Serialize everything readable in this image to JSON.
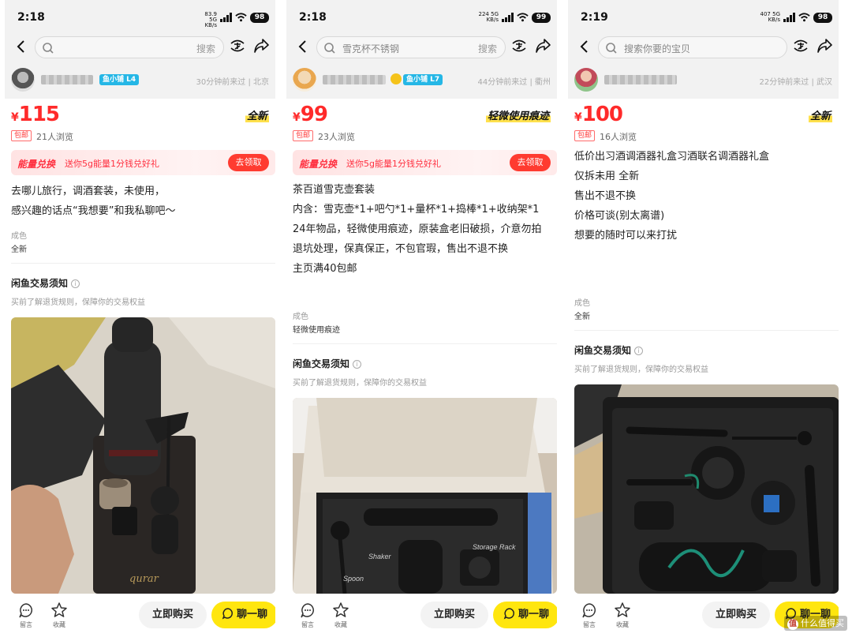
{
  "colors": {
    "accent": "#ffe60f",
    "price": "#ff2a2a",
    "promo": "#ff3b30",
    "badge": "#25b7e6"
  },
  "phones": [
    {
      "status": {
        "time": "2:18",
        "net_speed": "83.9",
        "net_gen": "5G",
        "net_unit": "KB/s",
        "battery": "98"
      },
      "search": {
        "placeholder": "",
        "button": "搜索"
      },
      "seller": {
        "badge": "鱼小铺 L4",
        "last_seen": "30分钟前来过 | 北京"
      },
      "price": {
        "currency": "¥",
        "value": "115"
      },
      "condition_tag": "全新",
      "shipping_tag": "包邮",
      "views": "21人浏览",
      "promo": {
        "title": "能量兑换",
        "text": "送你5g能量1分钱兑好礼",
        "button": "去领取"
      },
      "description": [
        "去哪儿旅行，调酒套装，未使用，",
        "感兴趣的话点“我想要”和我私聊吧～"
      ],
      "condition_label": "成色",
      "condition_value": "全新",
      "notice": {
        "title": "闲鱼交易须知",
        "info_icon": "i",
        "subtitle": "买前了解退货规则，保障你的交易权益"
      },
      "photo_text": "qurar",
      "bottom": {
        "comment_label": "留言",
        "favorite_label": "收藏",
        "buy": "立即购买",
        "chat": "聊一聊"
      }
    },
    {
      "status": {
        "time": "2:18",
        "net_speed": "224",
        "net_gen": "5G",
        "net_unit": "KB/s",
        "battery": "99"
      },
      "search": {
        "placeholder": "雪克杯不锈钢",
        "button": "搜索"
      },
      "seller": {
        "badge": "鱼小铺 L7",
        "last_seen": "44分钟前来过 | 衢州"
      },
      "price": {
        "currency": "¥",
        "value": "99"
      },
      "condition_tag": "轻微使用痕迹",
      "shipping_tag": "包邮",
      "views": "23人浏览",
      "promo": {
        "title": "能量兑换",
        "text": "送你5g能量1分钱兑好礼",
        "button": "去领取"
      },
      "description": [
        "茶百道雪克壶套装",
        "内含：雪克壶*1+吧勺*1+量杯*1+捣棒*1+收纳架*1",
        "24年物品，轻微使用痕迹，原装盒老旧破损，介意勿拍",
        "退坑处理，保真保正，不包官瑕，售出不退不换",
        "主页满40包邮"
      ],
      "condition_label": "成色",
      "condition_value": "轻微使用痕迹",
      "notice": {
        "title": "闲鱼交易须知",
        "info_icon": "i",
        "subtitle": "买前了解退货规则，保障你的交易权益"
      },
      "photo_labels": {
        "shaker": "Shaker",
        "spoon": "Spoon",
        "rack": "Storage Rack"
      },
      "bottom": {
        "comment_label": "留言",
        "favorite_label": "收藏",
        "buy": "立即购买",
        "chat": "聊一聊"
      }
    },
    {
      "status": {
        "time": "2:19",
        "net_speed": "407",
        "net_gen": "5G",
        "net_unit": "KB/s",
        "battery": "98"
      },
      "search": {
        "placeholder": "搜索你要的宝贝",
        "button": ""
      },
      "seller": {
        "badge": "",
        "last_seen": "22分钟前来过 | 武汉"
      },
      "price": {
        "currency": "¥",
        "value": "100"
      },
      "condition_tag": "全新",
      "shipping_tag": "包邮",
      "views": "16人浏览",
      "description": [
        "低价出习酒调酒器礼盒习酒联名调酒器礼盒",
        "仅拆未用 全新",
        "售出不退不换",
        "价格可谈(别太离谱)",
        "想要的随时可以来打扰"
      ],
      "condition_label": "成色",
      "condition_value": "全新",
      "notice": {
        "title": "闲鱼交易须知",
        "info_icon": "i",
        "subtitle": "买前了解退货规则，保障你的交易权益"
      },
      "bottom": {
        "comment_label": "留言",
        "favorite_label": "收藏",
        "buy": "立即购买",
        "chat": "聊一聊"
      }
    }
  ],
  "watermark": {
    "badge": "值",
    "text": "什么值得买"
  }
}
